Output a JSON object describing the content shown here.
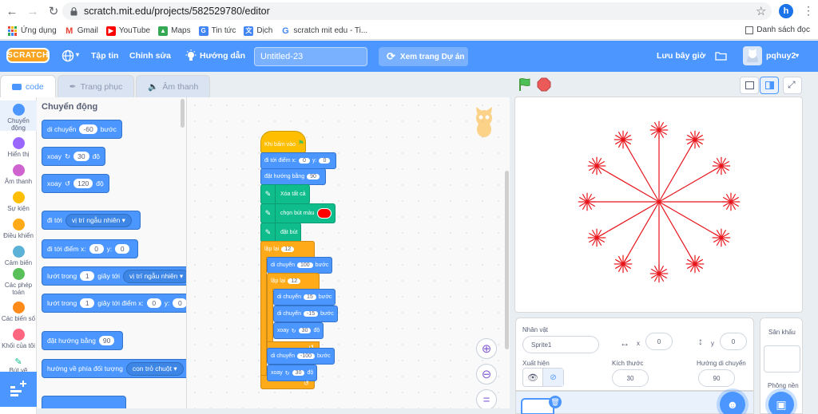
{
  "browser": {
    "url": "scratch.mit.edu/projects/582529780/editor",
    "profile_initial": "h",
    "bookmarks": [
      {
        "label": "Ứng dụng",
        "color": "#e8453c"
      },
      {
        "label": "Gmail",
        "color": "#ea4335"
      },
      {
        "label": "YouTube",
        "color": "#ff0000"
      },
      {
        "label": "Maps",
        "color": "#34a853"
      },
      {
        "label": "Tin tức",
        "color": "#4285f4"
      },
      {
        "label": "Dịch",
        "color": "#4285f4"
      },
      {
        "label": "scratch mit edu - Ti...",
        "color": "#4285f4"
      }
    ],
    "reading_list": "Danh sách đọc"
  },
  "menubar": {
    "logo": "SCRATCH",
    "file": "Tập tin",
    "edit": "Chỉnh sửa",
    "tutorials": "Hướng dẫn",
    "project_title": "Untitled-23",
    "see_project": "Xem trang Dự án",
    "save_now": "Lưu bây giờ",
    "username": "pqhuy2",
    "accent": "#4c97ff"
  },
  "tabs": {
    "code": "code",
    "costumes": "Trang phục",
    "sounds": "Âm thanh"
  },
  "categories": [
    {
      "label": "Chuyển động",
      "color": "#4c97ff"
    },
    {
      "label": "Hiển thị",
      "color": "#9966ff"
    },
    {
      "label": "Âm thanh",
      "color": "#cf63cf"
    },
    {
      "label": "Sự kiện",
      "color": "#ffbf00"
    },
    {
      "label": "Điều khiển",
      "color": "#ffab19"
    },
    {
      "label": "Cảm biến",
      "color": "#5cb1d6"
    },
    {
      "label": "Các phép toán",
      "color": "#59c059"
    },
    {
      "label": "Các biến số",
      "color": "#ff8c1a"
    },
    {
      "label": "Khối của tôi",
      "color": "#ff6680"
    },
    {
      "label": "Bút vẽ",
      "color": "#0fbd8c"
    }
  ],
  "palette": {
    "title": "Chuyển động",
    "move": {
      "text": "di chuyển",
      "value": "-60",
      "suffix": "bước"
    },
    "turn_right": {
      "text": "xoay",
      "value": "30",
      "suffix": "độ"
    },
    "turn_left": {
      "text": "xoay",
      "value": "120",
      "suffix": "độ"
    },
    "goto": {
      "text": "đi tới",
      "dropdown": "vị trí ngẫu nhiên"
    },
    "goto_xy": {
      "text": "đi tới điểm x:",
      "x": "0",
      "ylabel": "y:",
      "y": "0"
    },
    "glide": {
      "text": "lướt trong",
      "value": "1",
      "mid": "giây tới",
      "dropdown": "vị trí ngẫu nhiên"
    },
    "glide_xy": {
      "text": "lướt trong",
      "value": "1",
      "mid": "giây tới điểm x:",
      "x": "0",
      "ylabel": "y:",
      "y": "0"
    },
    "point_dir": {
      "text": "đặt hướng bằng",
      "value": "90"
    },
    "point_towards": {
      "text": "hướng về phía đối tượng",
      "dropdown": "con trỏ chuột"
    }
  },
  "script": {
    "hat": "Khi bấm vào",
    "goto_xy": {
      "text": "đi tới điểm x:",
      "x": "0",
      "ylabel": "y:",
      "y": "0"
    },
    "point_dir": {
      "text": "đặt hướng bằng",
      "value": "90"
    },
    "clear": "Xóa tất cả",
    "set_pen_color": {
      "text": "chọn bút màu",
      "color": "#ff0000"
    },
    "pen_down": "đặt bút",
    "repeat_outer": {
      "text": "lặp lại",
      "value": "12"
    },
    "move_100": {
      "text": "di chuyển",
      "value": "100",
      "suffix": "bước"
    },
    "repeat_inner": {
      "text": "lặp lại",
      "value": "12"
    },
    "move_15": {
      "text": "di chuyển",
      "value": "15",
      "suffix": "bước"
    },
    "move_m15": {
      "text": "di chuyển",
      "value": "-15",
      "suffix": "bước"
    },
    "turn_30_a": {
      "text": "xoay",
      "value": "30",
      "suffix": "độ"
    },
    "move_m100": {
      "text": "di chuyển",
      "value": "-100",
      "suffix": "bước"
    },
    "turn_30_b": {
      "text": "xoay",
      "value": "30",
      "suffix": "độ"
    }
  },
  "stage": {
    "drawing": {
      "spokes": 12,
      "radius": 90,
      "burst_lines": 12,
      "burst_radius": 15,
      "color": "#e8151c"
    }
  },
  "sprite_info": {
    "sprite_label": "Nhân vật",
    "sprite_name": "Sprite1",
    "x_label": "x",
    "x_value": "0",
    "y_label": "y",
    "y_value": "0",
    "show_label": "Xuất hiện",
    "size_label": "Kích thước",
    "size_value": "30",
    "direction_label": "Hướng di chuyển",
    "direction_value": "90"
  },
  "stage_pane": {
    "title": "Sân khấu",
    "backdrops_label": "Phông nền"
  }
}
